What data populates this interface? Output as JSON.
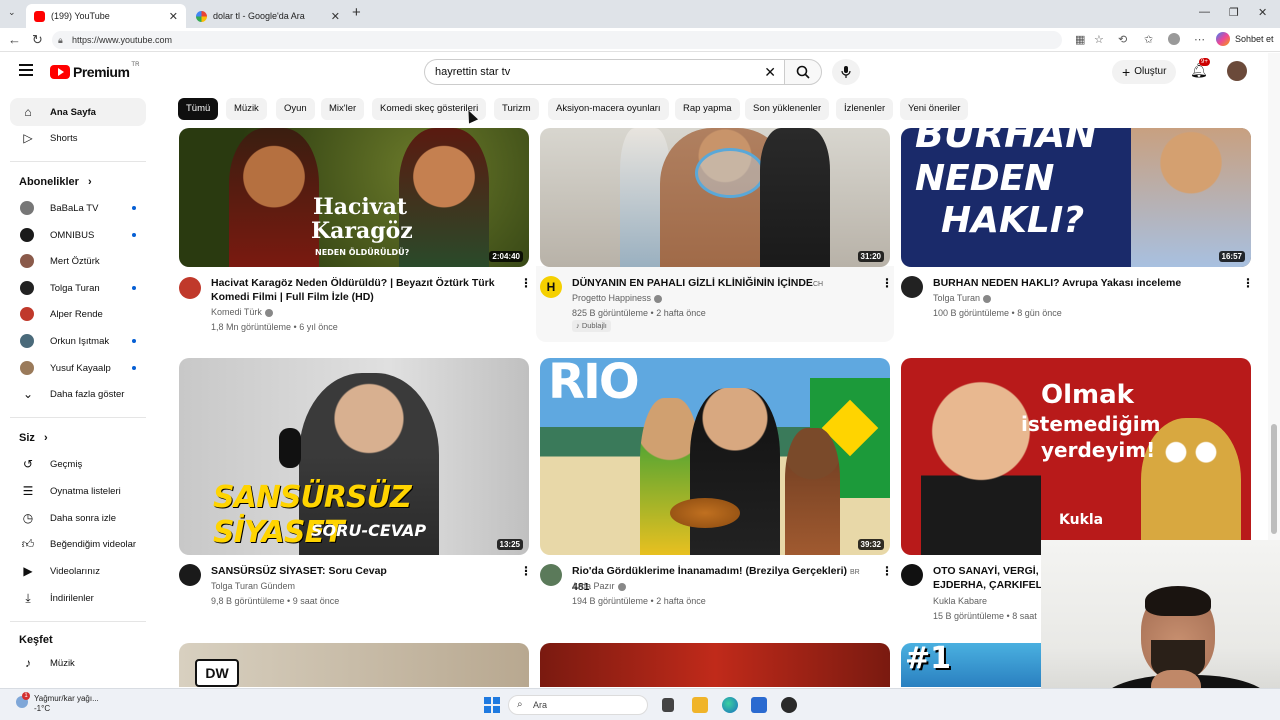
{
  "browser": {
    "tabs": [
      {
        "title": "(199) YouTube",
        "active": true
      },
      {
        "title": "dolar tl - Google'da Ara",
        "active": false
      }
    ],
    "url": "https://www.youtube.com",
    "copilot_label": "Sohbet et"
  },
  "header": {
    "logo_text": "Premium",
    "logo_region": "TR",
    "search_value": "hayrettin star tv",
    "create_label": "Oluştur",
    "notifications_badge": "9+"
  },
  "sidebar": {
    "main": [
      {
        "label": "Ana Sayfa",
        "icon": "home-icon",
        "active": true
      },
      {
        "label": "Shorts",
        "icon": "shorts-icon",
        "active": false
      }
    ],
    "subscriptions_title": "Abonelikler",
    "subscriptions": [
      {
        "label": "BaBaLa TV",
        "dot": true,
        "color": "#777777"
      },
      {
        "label": "OMNIBUS",
        "dot": true,
        "color": "#1a1a1a"
      },
      {
        "label": "Mert Öztürk",
        "dot": false,
        "color": "#8a5a4a"
      },
      {
        "label": "Tolga Turan",
        "dot": true,
        "color": "#222222"
      },
      {
        "label": "Alper Rende",
        "dot": false,
        "color": "#c0392b"
      },
      {
        "label": "Orkun Işıtmak",
        "dot": true,
        "color": "#4a6a7a"
      },
      {
        "label": "Yusuf Kayaalp",
        "dot": true,
        "color": "#9a7a5a"
      }
    ],
    "show_more": "Daha fazla göster",
    "you_title": "Siz",
    "you_items": [
      {
        "label": "Geçmiş",
        "icon": "history-icon"
      },
      {
        "label": "Oynatma listeleri",
        "icon": "playlists-icon"
      },
      {
        "label": "Daha sonra izle",
        "icon": "watch-later-icon"
      },
      {
        "label": "Beğendiğim videolar",
        "icon": "like-icon"
      },
      {
        "label": "Videolarınız",
        "icon": "your-videos-icon"
      },
      {
        "label": "İndirilenler",
        "icon": "download-icon"
      }
    ],
    "explore_title": "Keşfet",
    "explore_items": [
      {
        "label": "Müzik",
        "icon": "music-icon"
      }
    ]
  },
  "chips": [
    "Tümü",
    "Müzik",
    "Oyun",
    "Mix'ler",
    "Komedi skeç gösterileri",
    "Turizm",
    "Aksiyon-macera oyunları",
    "Rap yapma",
    "Son yüklenenler",
    "İzlenenler",
    "Yeni öneriler"
  ],
  "videos": [
    {
      "title_line1": "Hacivat Karagöz Neden Öldürüldü? | Beyazıt Öztürk Türk",
      "title_line2": "Komedi Filmi | Full Film İzle (HD)",
      "channel": "Komedi Türk",
      "verified": true,
      "meta": "1,8 Mn görüntüleme • 6 yıl önce",
      "duration": "2:04:40",
      "thumb_text1": "Hacivat",
      "thumb_text2": "Karagöz",
      "thumb_text3": "NEDEN ÖLDÜRÜLDÜ?",
      "avatar_color": "#c0392b"
    },
    {
      "title_line1": "DÜNYANIN EN PAHALI GİZLİ KLİNİĞİNİN İÇİNDE",
      "title_tag": "CH",
      "channel": "Progetto Happiness",
      "verified": true,
      "meta": "825 B görüntüleme • 2 hafta önce",
      "badge": "Dublajlı",
      "duration": "31:20",
      "avatar_letter": "H",
      "avatar_color": "#f5d000"
    },
    {
      "title_line1": "BURHAN NEDEN HAKLI? Avrupa Yakası inceleme",
      "channel": "Tolga Turan",
      "verified": true,
      "meta": "100 B görüntüleme • 8 gün önce",
      "duration": "16:57",
      "thumb_text1": "BURHAN",
      "thumb_text2": "NEDEN",
      "thumb_text3": "HAKLI?",
      "avatar_color": "#222222"
    },
    {
      "title_line1": "SANSÜRSÜZ SİYASET: Soru Cevap",
      "channel": "Tolga Turan Gündem",
      "verified": false,
      "meta": "9,8 B görüntüleme • 9 saat önce",
      "duration": "13:25",
      "thumb_text1": "SANSÜRSÜZ SİYASET",
      "thumb_text2": "SORU-CEVAP",
      "avatar_color": "#1a1a1a"
    },
    {
      "title_line1": "Rio'da Gördüklerime İnanamadım! (Brezilya Gerçekleri)",
      "title_tag": "BR",
      "title_suffix": "481",
      "channel": "Arda Pazır",
      "verified": true,
      "meta": "194 B görüntüleme • 2 hafta önce",
      "duration": "39:32",
      "thumb_text1": "RIO",
      "avatar_color": "#5b7a5a"
    },
    {
      "title_line1": "OTO SANAYİ, VERGİ, V",
      "title_line2": "EJDERHA, ÇARKIFELE",
      "channel": "Kukla Kabare",
      "verified": false,
      "meta": "15 B görüntüleme • 8 saat",
      "thumb_text1": "Olmak",
      "thumb_text2": "istemediğim",
      "thumb_text3": "yerdeyim!",
      "thumb_text4": "Kukla",
      "avatar_color": "#111111"
    }
  ],
  "row3_thumbs": [
    {
      "text": "DW"
    },
    {
      "text": ""
    },
    {
      "text": "#1"
    }
  ],
  "taskbar": {
    "weather_line1": "Yağmur/kar yağı...",
    "weather_line2": "-1°C",
    "weather_badge": "1",
    "search_placeholder": "Ara"
  }
}
